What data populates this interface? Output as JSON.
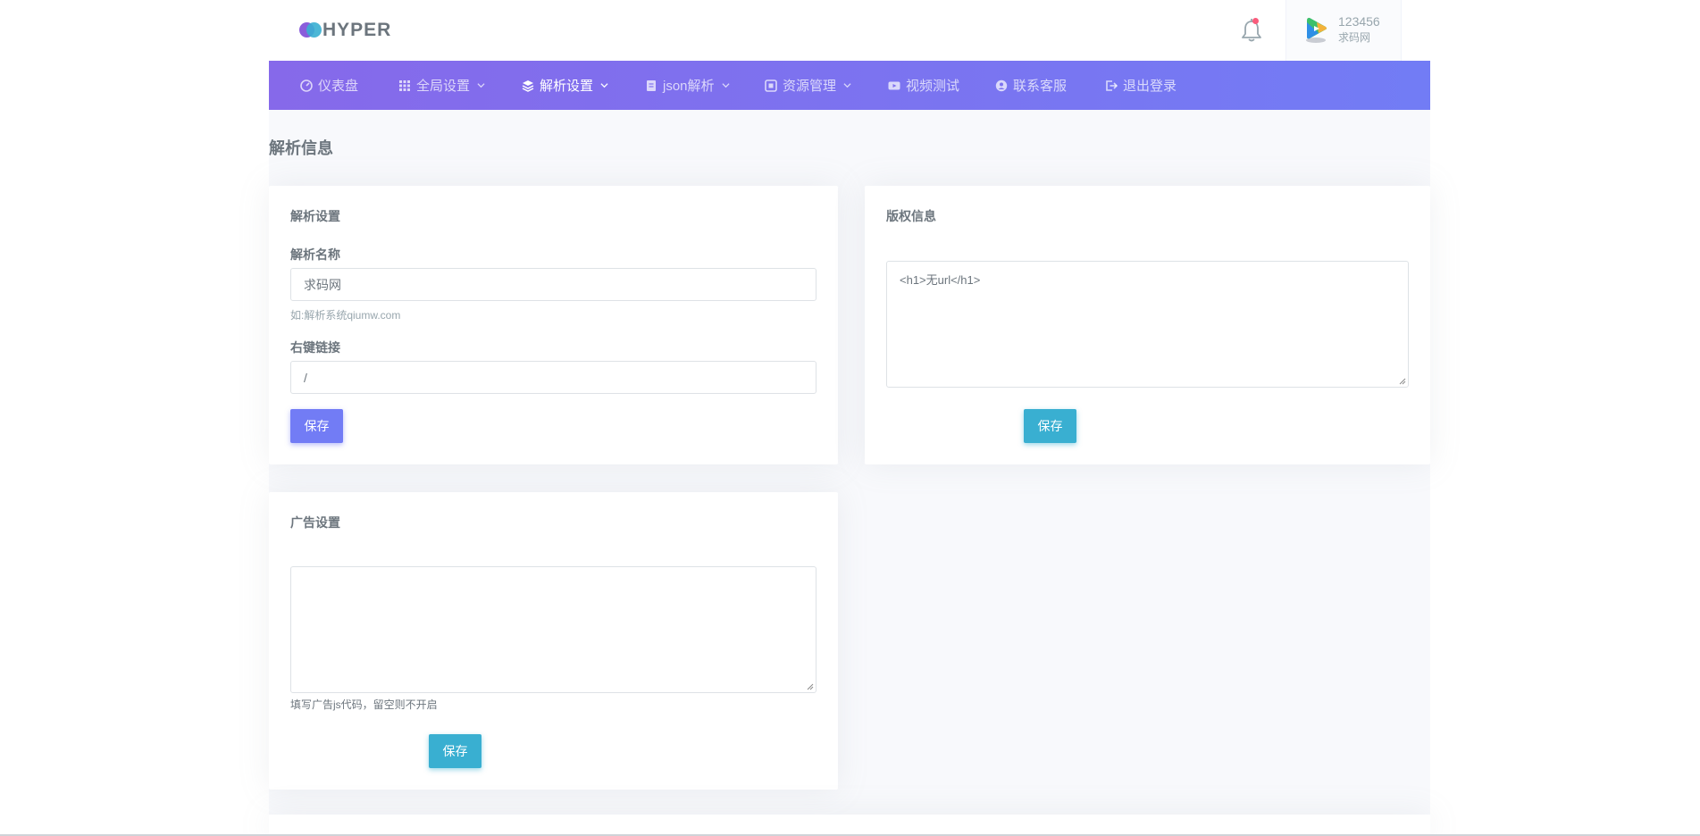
{
  "brand": {
    "name": "HYPER"
  },
  "user": {
    "name": "123456",
    "subtitle": "求码网"
  },
  "nav": {
    "items": [
      {
        "label": "仪表盘",
        "icon": "gauge-icon",
        "dropdown": false,
        "active": false
      },
      {
        "label": "全局设置",
        "icon": "grid-icon",
        "dropdown": true,
        "active": false
      },
      {
        "label": "解析设置",
        "icon": "layers-icon",
        "dropdown": true,
        "active": true
      },
      {
        "label": "json解析",
        "icon": "doc-icon",
        "dropdown": true,
        "active": false
      },
      {
        "label": "资源管理",
        "icon": "resource-icon",
        "dropdown": true,
        "active": false
      },
      {
        "label": "视频测试",
        "icon": "video-icon",
        "dropdown": false,
        "active": false
      },
      {
        "label": "联系客服",
        "icon": "user-circle-icon",
        "dropdown": false,
        "active": false
      },
      {
        "label": "退出登录",
        "icon": "logout-icon",
        "dropdown": false,
        "active": false
      }
    ]
  },
  "page": {
    "title": "解析信息"
  },
  "parse_settings": {
    "title": "解析设置",
    "name_label": "解析名称",
    "name_value": "求码网",
    "name_help": "如:解析系统qiumw.com",
    "link_label": "右键链接",
    "link_value": "/",
    "save_label": "保存"
  },
  "copyright": {
    "title": "版权信息",
    "content": "<h1>无url</h1>",
    "save_label": "保存"
  },
  "ads": {
    "title": "广告设置",
    "content": "",
    "help": "填写广告js代码，留空则不开启",
    "save_label": "保存"
  },
  "colors": {
    "primary": "#727cf5",
    "info": "#39afd1",
    "nav_start": "#8669ea",
    "nav_end": "#727cf5",
    "notification": "#fa5c7c"
  }
}
